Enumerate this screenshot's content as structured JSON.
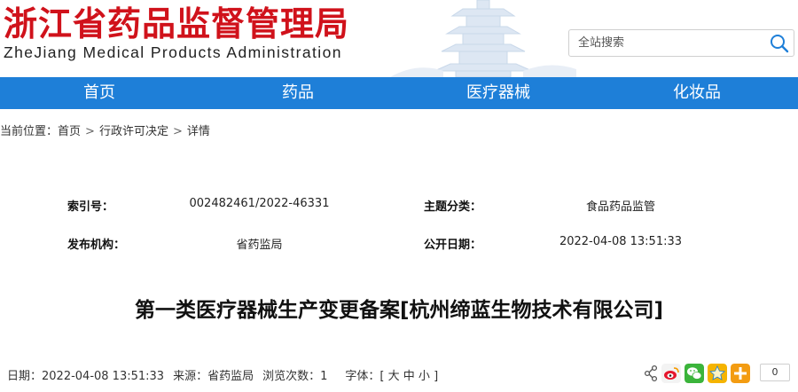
{
  "header": {
    "title_cn": "浙江省药品监督管理局",
    "title_en": "ZheJiang Medical Products Administration",
    "brand_color": "#d0121b",
    "search": {
      "placeholder": "全站搜索",
      "icon": "search-icon"
    }
  },
  "nav": {
    "color": "#1e7fd8",
    "items": [
      {
        "label": "首页"
      },
      {
        "label": "药品"
      },
      {
        "label": "医疗器械"
      },
      {
        "label": "化妆品"
      }
    ]
  },
  "breadcrumb": {
    "prefix": "当前位置：",
    "items": [
      "首页",
      "行政许可决定",
      "详情"
    ],
    "separator": ">"
  },
  "metadata": {
    "index_no": {
      "label": "索引号：",
      "value": "002482461/2022-46331"
    },
    "topic": {
      "label": "主题分类：",
      "value": "食品药品监管"
    },
    "publisher": {
      "label": "发布机构：",
      "value": "省药监局"
    },
    "publish_date": {
      "label": "公开日期：",
      "value": "2022-04-08 13:51:33"
    }
  },
  "document": {
    "title": "第一类医疗器械生产变更备案[杭州缔蓝生物技术有限公司]"
  },
  "info_bar": {
    "date": "日期：2022-04-08 13:51:33",
    "source": "来源：省药监局",
    "views": "浏览次数：1",
    "font_label": "字体：[",
    "font_large": "大",
    "font_medium": "中",
    "font_small": "小",
    "font_end": "]"
  },
  "share": {
    "icons": [
      "share-icon",
      "weibo-icon",
      "wechat-icon",
      "qzone-icon",
      "more-share-icon"
    ],
    "count": "0"
  }
}
